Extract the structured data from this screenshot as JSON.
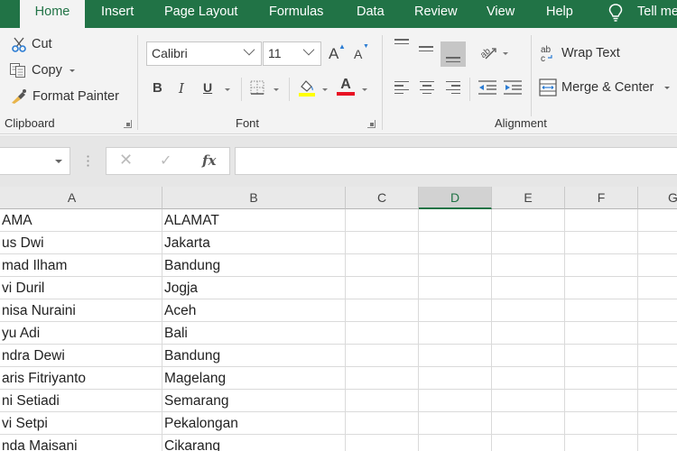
{
  "tabs": [
    {
      "label": "Home",
      "active": true
    },
    {
      "label": "Insert",
      "active": false
    },
    {
      "label": "Page Layout",
      "active": false
    },
    {
      "label": "Formulas",
      "active": false
    },
    {
      "label": "Data",
      "active": false
    },
    {
      "label": "Review",
      "active": false
    },
    {
      "label": "View",
      "active": false
    },
    {
      "label": "Help",
      "active": false
    }
  ],
  "tell_me": {
    "label": "Tell me",
    "icon": "lightbulb-icon"
  },
  "ribbon": {
    "clipboard": {
      "label": "Clipboard",
      "cut": "Cut",
      "copy": "Copy",
      "format_painter": "Format Painter"
    },
    "font": {
      "label": "Font",
      "font_name": "Calibri",
      "font_size": "11",
      "bold": "B",
      "italic": "I",
      "underline": "U",
      "grow": "A",
      "shrink": "A",
      "font_color_letter": "A"
    },
    "alignment": {
      "label": "Alignment",
      "wrap_text": "Wrap Text",
      "merge_center": "Merge & Center"
    }
  },
  "formula_bar": {
    "name_box": "",
    "cancel_icon": "✕",
    "enter_icon": "✓",
    "fx_label": "fx",
    "formula": ""
  },
  "colors": {
    "accent": "#217346",
    "fill_color": "#ffff00",
    "font_color": "#e81123"
  },
  "grid": {
    "columns": [
      "A",
      "B",
      "C",
      "D",
      "E",
      "F",
      "G"
    ],
    "selected_column": "D",
    "rows": [
      {
        "a": "AMA",
        "b": "ALAMAT"
      },
      {
        "a": "us Dwi",
        "b": "Jakarta"
      },
      {
        "a": "mad Ilham",
        "b": "Bandung"
      },
      {
        "a": "vi Duril",
        "b": "Jogja"
      },
      {
        "a": "nisa Nuraini",
        "b": "Aceh"
      },
      {
        "a": "yu Adi",
        "b": "Bali"
      },
      {
        "a": "ndra Dewi",
        "b": "Bandung"
      },
      {
        "a": "aris Fitriyanto",
        "b": "Magelang"
      },
      {
        "a": "ni Setiadi",
        "b": "Semarang"
      },
      {
        "a": "vi Setpi",
        "b": "Pekalongan"
      },
      {
        "a": "nda Maisani",
        "b": "Cikarang"
      }
    ]
  }
}
